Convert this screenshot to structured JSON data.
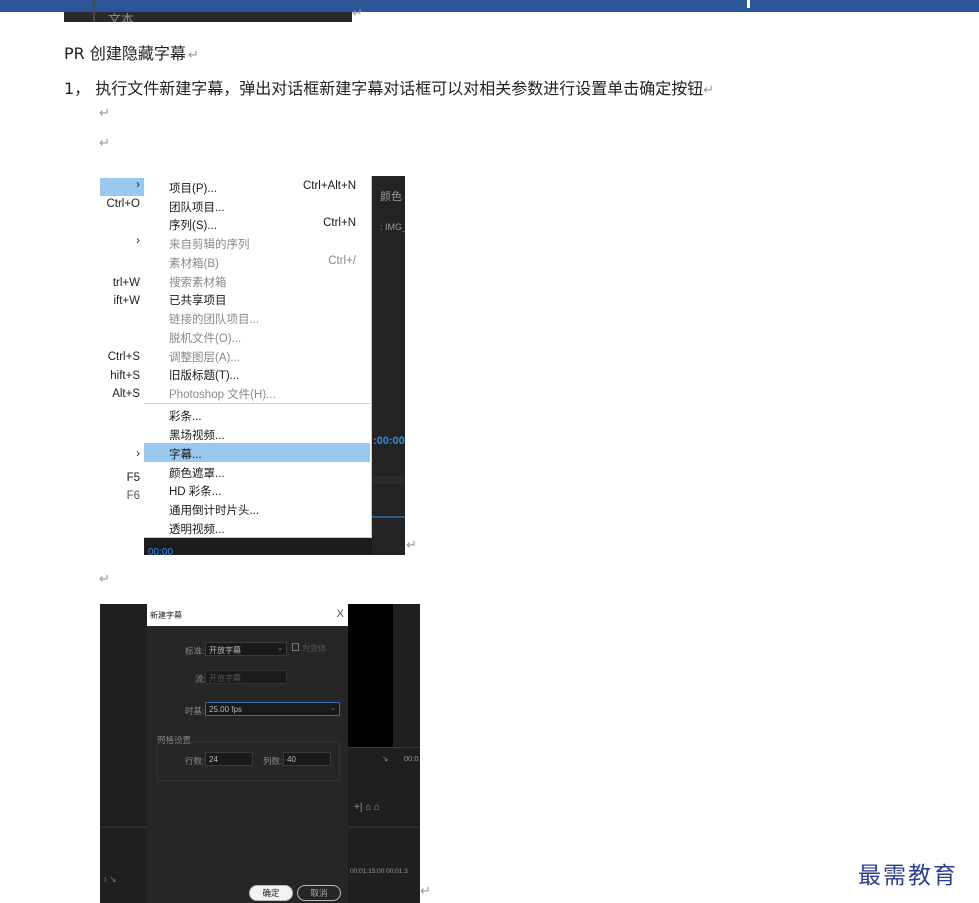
{
  "top_screenshot": {
    "text": "文本"
  },
  "paragraph_mark": "↵",
  "doc": {
    "title": "PR 创建隐藏字幕",
    "step1": "1，  执行文件新建字幕，弹出对话框新建字幕对话框可以对相关参数进行设置单击确定按钮"
  },
  "menu_screenshot": {
    "left_shortcuts": [
      "Ctrl+O",
      "trl+W",
      "ift+W",
      "Ctrl+S",
      "hift+S",
      "Alt+S",
      "F5",
      "F6"
    ],
    "right_panel": {
      "tab": "颜色",
      "clip": ": IMG_",
      "timecode": ":00:00",
      "bottom_timecode": "00:00"
    },
    "items": [
      {
        "label": "项目(P)...",
        "shortcut": "Ctrl+Alt+N",
        "enabled": true
      },
      {
        "label": "团队项目...",
        "shortcut": "",
        "enabled": true
      },
      {
        "label": "序列(S)...",
        "shortcut": "Ctrl+N",
        "enabled": true
      },
      {
        "label": "来自剪辑的序列",
        "shortcut": "",
        "enabled": false
      },
      {
        "label": "素材箱(B)",
        "shortcut": "Ctrl+/",
        "enabled": false
      },
      {
        "label": "搜索素材箱",
        "shortcut": "",
        "enabled": false
      },
      {
        "label": "已共享项目",
        "shortcut": "",
        "enabled": true
      },
      {
        "label": "链接的团队项目...",
        "shortcut": "",
        "enabled": false
      },
      {
        "label": "脱机文件(O)...",
        "shortcut": "",
        "enabled": false
      },
      {
        "label": "调整图层(A)...",
        "shortcut": "",
        "enabled": false
      },
      {
        "label": "旧版标题(T)...",
        "shortcut": "",
        "enabled": true
      },
      {
        "label": "Photoshop 文件(H)...",
        "shortcut": "",
        "enabled": false
      },
      {
        "label": "彩条...",
        "shortcut": "",
        "enabled": true
      },
      {
        "label": "黑场视频...",
        "shortcut": "",
        "enabled": true
      },
      {
        "label": "字幕...",
        "shortcut": "",
        "enabled": true,
        "highlighted": true
      },
      {
        "label": "颜色遮罩...",
        "shortcut": "",
        "enabled": true
      },
      {
        "label": "HD 彩条...",
        "shortcut": "",
        "enabled": true
      },
      {
        "label": "通用倒计时片头...",
        "shortcut": "",
        "enabled": true
      },
      {
        "label": "透明视频...",
        "shortcut": "",
        "enabled": true
      }
    ]
  },
  "dialog_screenshot": {
    "title": "新建字幕",
    "close": "X",
    "standard_label": "标准:",
    "standard_value": "开放字幕",
    "checkbox_label": "为变体",
    "stream_label": "流:",
    "stream_value": "开放字幕",
    "timebase_label": "时基:",
    "timebase_value": "25.00 fps",
    "grid_label": "网格设置",
    "rows_label": "行数:",
    "rows_value": "24",
    "cols_label": "列数:",
    "cols_value": "40",
    "ok_label": "确定",
    "cancel_label": "取消",
    "right_time1": "00:0",
    "right_time2": "00:01:15:00   00:01:3",
    "right_icons": "+|  ⌂  ⌂"
  },
  "watermark": "最需教育"
}
